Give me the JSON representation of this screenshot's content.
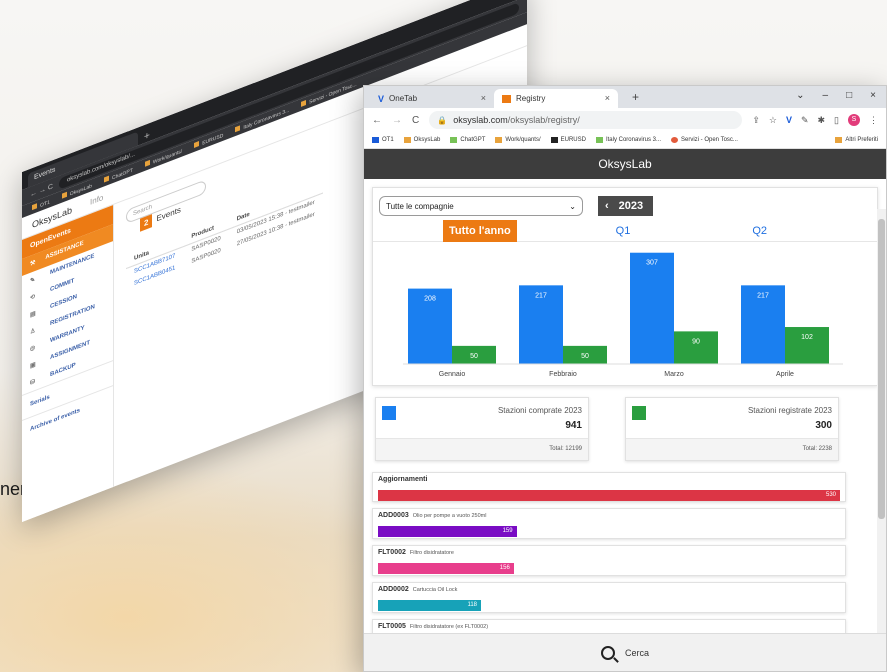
{
  "side_caption": "nent",
  "back_window": {
    "tab_title": "Events",
    "url": "oksyslab.com/oksyslab/...",
    "bookmarks": [
      "OT1",
      "OksysLab",
      "ChatGPT",
      "Work/quants/",
      "EURUSD",
      "Italy Coronavirus 3...",
      "Servizi - Open Tosc..."
    ],
    "brand": "OksysLab",
    "brand_sub": "Info",
    "sidebar_header": "OpenEvents",
    "sidebar_selected": "ASSISTANCE",
    "sidebar_items": [
      "MAINTENANCE",
      "COMMIT",
      "CESSION",
      "REGISTRATION",
      "WARRANTY",
      "ASSIGNMENT",
      "BACKUP"
    ],
    "sidebar_links": [
      "Serials",
      "Archive of events"
    ],
    "search_placeholder": "Search",
    "event_count": "2",
    "event_label": "Events",
    "table": {
      "headers": [
        "Unita",
        "Product",
        "Date"
      ],
      "rows": [
        [
          "SCC1ABB7107",
          "SASP0020",
          "03/05/2023 15:38 - testmailer"
        ],
        [
          "SCC1ABB0451",
          "SASP0020",
          "27/05/2023 10:38 - testmailer"
        ]
      ]
    }
  },
  "front_window": {
    "tabs": [
      {
        "title": "OneTab",
        "favicon": "v"
      },
      {
        "title": "Registry",
        "favicon": "orange"
      }
    ],
    "url_domain": "oksyslab.com",
    "url_path": "/oksyslab/registry/",
    "bookmarks": [
      {
        "label": "OT1",
        "kind": "b"
      },
      {
        "label": "OksysLab",
        "kind": "o"
      },
      {
        "label": "ChatGPT",
        "kind": "g"
      },
      {
        "label": "Work/quants/",
        "kind": "o"
      },
      {
        "label": "EURUSD",
        "kind": "d"
      },
      {
        "label": "Italy Coronavirus 3...",
        "kind": "g"
      },
      {
        "label": "Servizi - Open Tosc...",
        "kind": "r"
      }
    ],
    "bookmarks_more": "Altri Preferiti",
    "avatar_letter": "S",
    "app_title": "OksysLab",
    "company_select": "Tutte le compagnie",
    "year": "2023",
    "period_tabs": [
      "Tutto l'anno",
      "Q1",
      "Q2"
    ],
    "colors": {
      "accent": "#ec7a13",
      "blue_series": "#1a7ff0",
      "green_series": "#2a9e3f"
    },
    "stats": [
      {
        "title": "Stazioni comprate 2023",
        "value": "941",
        "total": "Total: 12199",
        "color": "#1a7ff0"
      },
      {
        "title": "Stazioni registrate 2023",
        "value": "300",
        "total": "Total: 2238",
        "color": "#2a9e3f"
      }
    ],
    "updates": [
      {
        "code": "Aggiornamenti",
        "desc": "",
        "value": "530",
        "fraction": 1.0,
        "color": "#dc3545"
      },
      {
        "code": "ADD0003",
        "desc": "Olio per pompe a vuoto 250ml",
        "value": "159",
        "fraction": 0.3,
        "color": "#7a0cc4"
      },
      {
        "code": "FLT0002",
        "desc": "Filtro disidratatore",
        "value": "156",
        "fraction": 0.294,
        "color": "#e83e8c"
      },
      {
        "code": "ADD0002",
        "desc": "Cartuccia Oil Lock",
        "value": "118",
        "fraction": 0.223,
        "color": "#17a2b8"
      },
      {
        "code": "FLT0005",
        "desc": "Filtro disidratatore (ex FLT0002)",
        "value": "",
        "fraction": 0.04,
        "color": "#2a9e3f"
      }
    ],
    "search_label": "Cerca"
  },
  "chart_data": {
    "type": "bar",
    "categories": [
      "Gennaio",
      "Febbraio",
      "Marzo",
      "Aprile"
    ],
    "series": [
      {
        "name": "",
        "values": [
          208,
          217,
          307,
          217
        ],
        "color": "#1a7ff0"
      },
      {
        "name": "",
        "values": [
          50,
          50,
          90,
          102
        ],
        "color": "#2a9e3f"
      }
    ],
    "ylim": [
      0,
      320
    ],
    "grid": false,
    "legend": "none"
  }
}
